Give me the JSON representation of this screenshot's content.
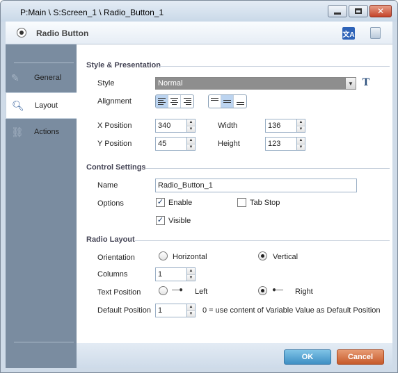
{
  "window": {
    "title": "P:Main \\ S:Screen_1 \\ Radio_Button_1",
    "controls": [
      "minimize",
      "maximize",
      "close"
    ]
  },
  "header": {
    "title": "Radio Button",
    "icons": [
      "radio-button-icon",
      "translate-icon",
      "note-icon"
    ]
  },
  "sidebar": {
    "items": [
      {
        "label": "General",
        "icon": "pen-icon",
        "active": false
      },
      {
        "label": "Layout",
        "icon": "magnifier-icon",
        "active": true
      },
      {
        "label": "Actions",
        "icon": "link-icon",
        "active": false
      }
    ]
  },
  "style_presentation": {
    "heading": "Style & Presentation",
    "style_label": "Style",
    "style_value": "Normal",
    "alignment_label": "Alignment",
    "x_label": "X Position",
    "x_value": "340",
    "y_label": "Y Position",
    "y_value": "45",
    "width_label": "Width",
    "width_value": "136",
    "height_label": "Height",
    "height_value": "123"
  },
  "control_settings": {
    "heading": "Control Settings",
    "name_label": "Name",
    "name_value": "Radio_Button_1",
    "options_label": "Options",
    "enable_label": "Enable",
    "enable_checked": true,
    "tabstop_label": "Tab Stop",
    "tabstop_checked": false,
    "visible_label": "Visible",
    "visible_checked": true
  },
  "radio_layout": {
    "heading": "Radio Layout",
    "orientation_label": "Orientation",
    "horizontal_label": "Horizontal",
    "vertical_label": "Vertical",
    "orientation_selected": "Vertical",
    "columns_label": "Columns",
    "columns_value": "1",
    "text_position_label": "Text Position",
    "left_label": "Left",
    "right_label": "Right",
    "text_position_selected": "Right",
    "default_position_label": "Default Position",
    "default_position_value": "1",
    "default_position_hint": "0 = use content of Variable Value as Default Position"
  },
  "footer": {
    "ok_label": "OK",
    "cancel_label": "Cancel"
  },
  "colors": {
    "sidebar": "#7a8ca0",
    "ok": "#3e8fc4",
    "cancel": "#c65a2b"
  }
}
